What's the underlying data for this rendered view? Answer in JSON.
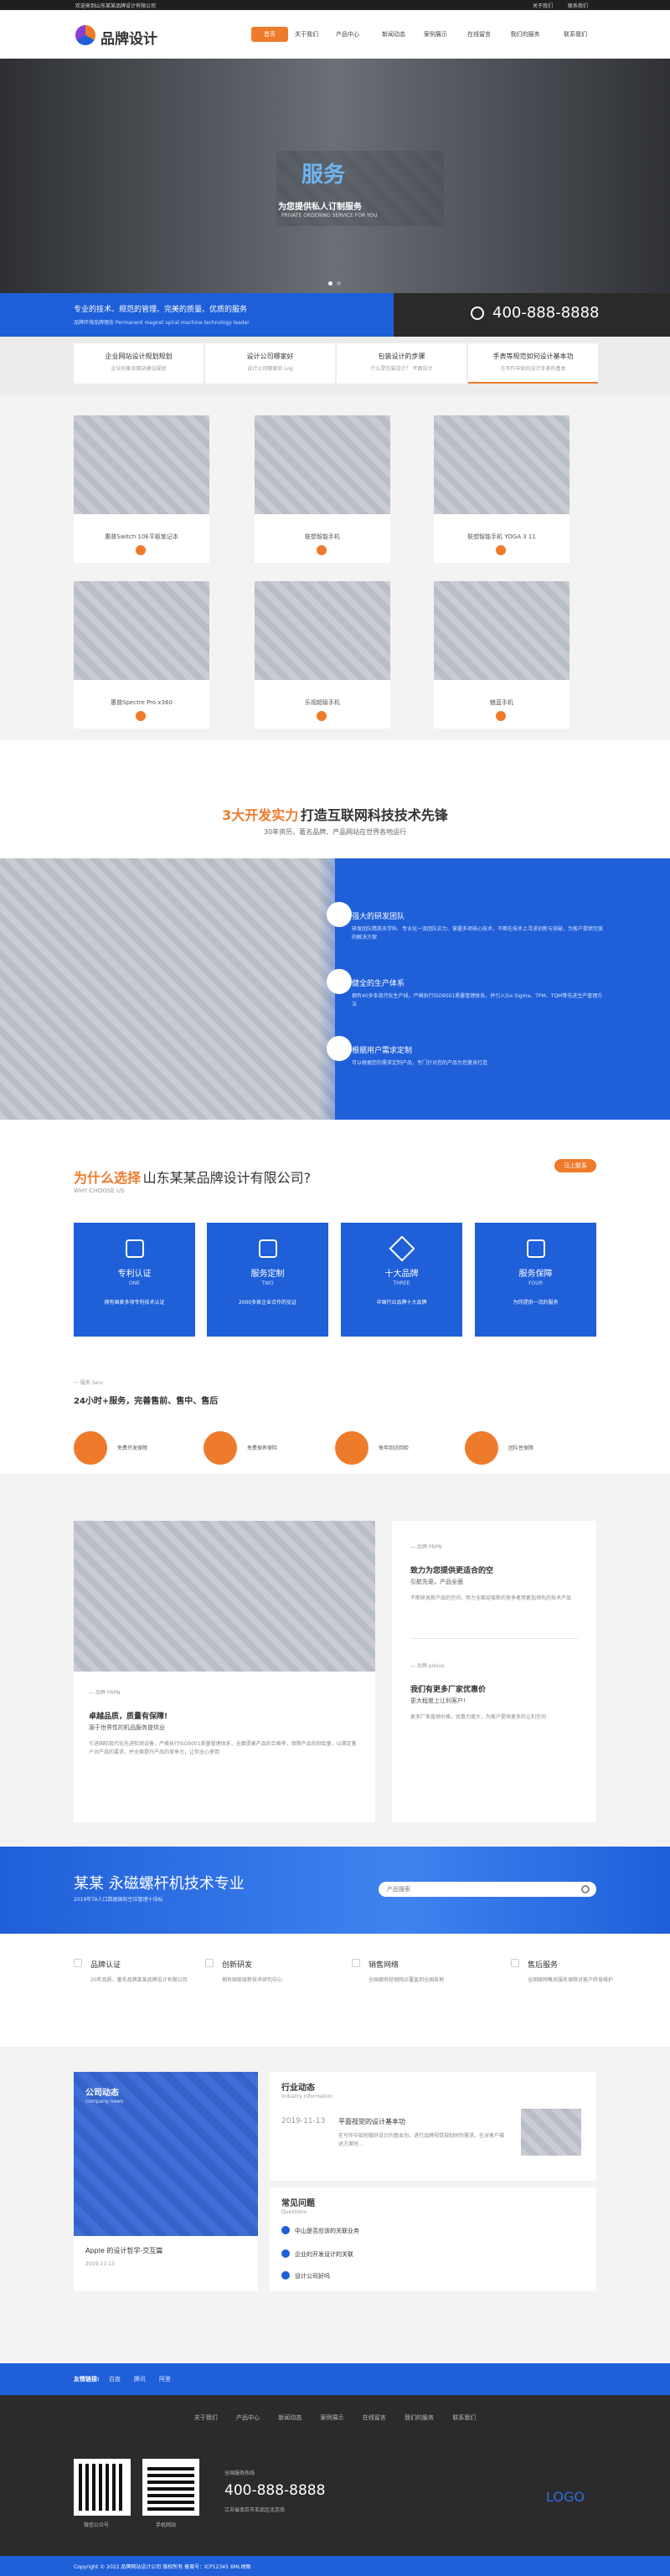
{
  "topbar": {
    "left": "欢迎来到山东某某品牌设计有限公司",
    "links": [
      "关于我们",
      "联系我们"
    ]
  },
  "brand": {
    "logo_text": "品牌设计"
  },
  "nav": [
    "首页",
    "关于我们",
    "产品中心",
    "新闻动态",
    "案例展示",
    "在线留言",
    "我们的服务",
    "联系我们"
  ],
  "hero": {
    "title": "服务",
    "subtitle": "为您提供私人订制服务",
    "subtitle_en": "PRIVATE ORDERING SERVICE FOR YOU"
  },
  "strip": {
    "line1": "专业的技术、规范的管理、完美的质量、优质的服务",
    "line2": "品牌环境品牌理念 Permanent magnet spiral machine technology leader",
    "phone": "400-888-8888"
  },
  "features": [
    {
      "title": "企业网站设计规划规划",
      "sub": "企业形象及网站建设规划"
    },
    {
      "title": "设计公司哪家好",
      "sub": "设计公司哪家好 Log"
    },
    {
      "title": "包装设计的步骤",
      "sub": "什么是包装设计？ 平面设计"
    },
    {
      "title": "手表等规范如何设计基本功",
      "sub": "在写作中如何设计手表的基本"
    }
  ],
  "products": [
    {
      "title": "惠普Switch 10E平板笔记本"
    },
    {
      "title": "联想智能手机"
    },
    {
      "title": "联想智能手机 YOGA 3 11"
    },
    {
      "title": "惠普Spectre Pro x360"
    },
    {
      "title": "乐视超级手机"
    },
    {
      "title": "魅蓝手机"
    }
  ],
  "sec3_head": {
    "accent": "3大开发实力",
    "rest": "打造互联网科技技术先锋",
    "sub": "30年资历、著名品牌、产品网站在世界各地运行"
  },
  "sec3_items": [
    {
      "title": "强大的研发团队",
      "desc": "研发团队精英多学科、专业化一流团队实力、掌握多项核心技术，不断在技术上寻求创新与突破，为客户提供完美的解决方案"
    },
    {
      "title": "健全的生产体系",
      "desc": "拥有40多条现代化生产线，严格执行ISO9001质量管理体系，并引入Six-Sigma、TPM、TQM等先进生产管理方法"
    },
    {
      "title": "根据用户需求定制",
      "desc": "可以根据您的需求定制产品，专门针对您的产品为您量身打造"
    }
  ],
  "why": {
    "accent": "为什么选择",
    "rest": "山东某某品牌设计有限公司?",
    "sub": "WHY CHOOSE US",
    "more": "马上联系"
  },
  "why_boxes": [
    {
      "title": "专利认证",
      "en": "ONE",
      "desc": "拥有国家多项专利技术认证"
    },
    {
      "title": "服务定制",
      "en": "TWO",
      "desc": "2000多家企业合作的见证"
    },
    {
      "title": "十大品牌",
      "en": "THREE",
      "desc": "中国行业品牌十大品牌"
    },
    {
      "title": "服务保障",
      "en": "FOUR",
      "desc": "为你提供一流的服务"
    }
  ],
  "service_line": {
    "label": "一 服务 Serv",
    "headline": "24小时+服务，完善售前、售中、售后"
  },
  "service_icons": [
    "免费开发保障",
    "免费保养保险",
    "每年回访回检",
    "团队性保障"
  ],
  "news_left": {
    "tag": "— 品牌 PRPN",
    "title": "卓越品质，质量有保障!",
    "sub": "源于世界性的机品服务提供业",
    "desc": "引进国际现代化先进检测设备，严格执行ISO9001质量管理体系，全面提高产品的合格率，保障产品的供给量，以满足客户对产品的要求，并全面提升产品的竞争力，让你全心使用"
  },
  "news_right": [
    {
      "tag": "— 品牌 PRPN",
      "title": "致力为您提供更适合的空",
      "sub": "引航先驱，产品全面",
      "desc": "不断研发新产品的空间，努力全面迎接新的竞争者用更加领先的技术产品"
    },
    {
      "tag": "— 品牌 prelux",
      "title": "我们有更多厂家优惠价",
      "sub": "更大程度上让利客户!",
      "desc": "更多厂家直销价格，优惠力度大，为客户提供更多的让利空间"
    }
  ],
  "banner2": {
    "title": "某某 永磁螺杆机技术专业",
    "sub": "2019年TA人口数据国际空压管理十倍标",
    "search_placeholder": "产品搜索"
  },
  "svc": [
    {
      "title": "品牌认证",
      "desc": "20年品质，著名品牌某某品牌设计有限公司"
    },
    {
      "title": "创新研发",
      "desc": "拥有国家级新技术研究中心"
    },
    {
      "title": "销售网络",
      "desc": "全国拥有经销网点覆盖到全国各地"
    },
    {
      "title": "售后服务",
      "desc": "全国联网售后服务保障对客户终身维护"
    }
  ],
  "news_block": {
    "title": "公司动态",
    "en": "company news",
    "caption": "Apple 的设计哲学-交互篇",
    "date": "2019-11-13"
  },
  "industry": {
    "title": "行业动态",
    "en": "Industry information",
    "date": "2019-11-13",
    "headline": "平面视觉的设计基本功",
    "desc": "在写作中如何做好设计的基本功，进行品牌视觉规划时的需求，在对客户描述方案时..."
  },
  "faq": {
    "title": "常见问题",
    "en": "Questions",
    "items": [
      "中山是否应该的关联业务",
      "企业的开发设计的关联",
      "设计公司好吗"
    ]
  },
  "links": {
    "label": "友情链接:",
    "items": [
      "百度",
      "腾讯",
      "阿里"
    ]
  },
  "footer_nav": [
    "关于我们",
    "产品中心",
    "新闻动态",
    "案例展示",
    "在线留言",
    "我们的服务",
    "联系我们"
  ],
  "footer": {
    "hotline_label": "全国服务热线",
    "hotline": "400-888-8888",
    "addr": "江苏省南京市玄武区北京南",
    "qr1": "微信公众号",
    "qr2": "手机网站",
    "logo": "LOGO"
  },
  "copyright": "Copyright © 2022 品牌网站设计公司 版权所有 备案号：ICP12345 XML地图"
}
